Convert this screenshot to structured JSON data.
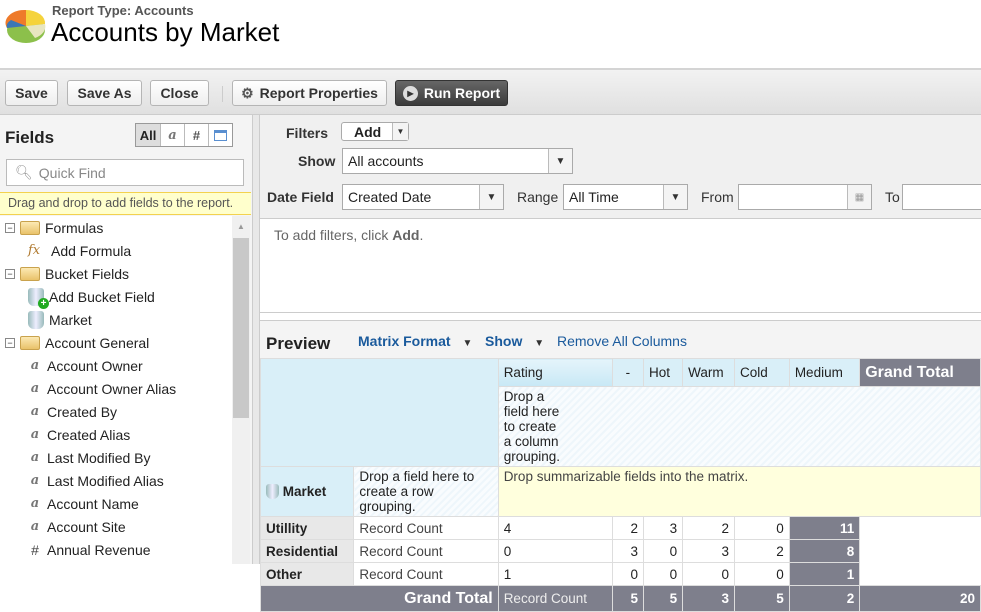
{
  "header": {
    "report_type": "Report Type: Accounts",
    "title": "Accounts by Market"
  },
  "toolbar": {
    "save": "Save",
    "save_as": "Save As",
    "close": "Close",
    "report_properties": "Report Properties",
    "run_report": "Run Report"
  },
  "fields_panel": {
    "title": "Fields",
    "type_filters": [
      "All",
      "a",
      "#",
      "date"
    ],
    "quick_find_placeholder": "Quick Find",
    "hint": "Drag and drop to add fields to the report.",
    "tree": [
      {
        "label": "Formulas",
        "kind": "folder"
      },
      {
        "label": "Add Formula",
        "kind": "formula"
      },
      {
        "label": "Bucket Fields",
        "kind": "folder"
      },
      {
        "label": "Add Bucket Field",
        "kind": "add-bucket"
      },
      {
        "label": "Market",
        "kind": "bucket"
      },
      {
        "label": "Account General",
        "kind": "folder"
      },
      {
        "label": "Account Owner",
        "kind": "text"
      },
      {
        "label": "Account Owner Alias",
        "kind": "text"
      },
      {
        "label": "Created By",
        "kind": "text"
      },
      {
        "label": "Created Alias",
        "kind": "text"
      },
      {
        "label": "Last Modified By",
        "kind": "text"
      },
      {
        "label": "Last Modified Alias",
        "kind": "text"
      },
      {
        "label": "Account Name",
        "kind": "text"
      },
      {
        "label": "Account Site",
        "kind": "text"
      },
      {
        "label": "Annual Revenue",
        "kind": "number"
      }
    ]
  },
  "filters": {
    "filters_label": "Filters",
    "add_label": "Add",
    "show_label": "Show",
    "show_value": "All accounts",
    "date_field_label": "Date Field",
    "date_field_value": "Created Date",
    "range_label": "Range",
    "range_value": "All Time",
    "from_label": "From",
    "from_value": "",
    "to_label": "To",
    "to_value": "",
    "empty_prefix": "To add filters, click ",
    "empty_add": "Add",
    "empty_suffix": "."
  },
  "preview": {
    "title": "Preview",
    "format": "Matrix Format",
    "show": "Show",
    "remove_all": "Remove All Columns",
    "column_group": "Rating",
    "columns": [
      "-",
      "Hot",
      "Warm",
      "Cold",
      "Medium"
    ],
    "grand_total": "Grand Total",
    "drop_column": "Drop a field here to create a column grouping.",
    "row_group": "Market",
    "drop_row": "Drop a field here to create a row grouping.",
    "drop_summary": "Drop summarizable fields into the matrix.",
    "measure": "Record Count",
    "rows": [
      {
        "label": "Utillity",
        "values": [
          "4",
          "2",
          "3",
          "2",
          "0"
        ],
        "total": "11"
      },
      {
        "label": "Residential",
        "values": [
          "0",
          "3",
          "0",
          "3",
          "2"
        ],
        "total": "8"
      },
      {
        "label": "Other",
        "values": [
          "1",
          "0",
          "0",
          "0",
          "0"
        ],
        "total": "1"
      }
    ],
    "totals": {
      "values": [
        "5",
        "5",
        "3",
        "5",
        "2"
      ],
      "total": "20"
    }
  }
}
